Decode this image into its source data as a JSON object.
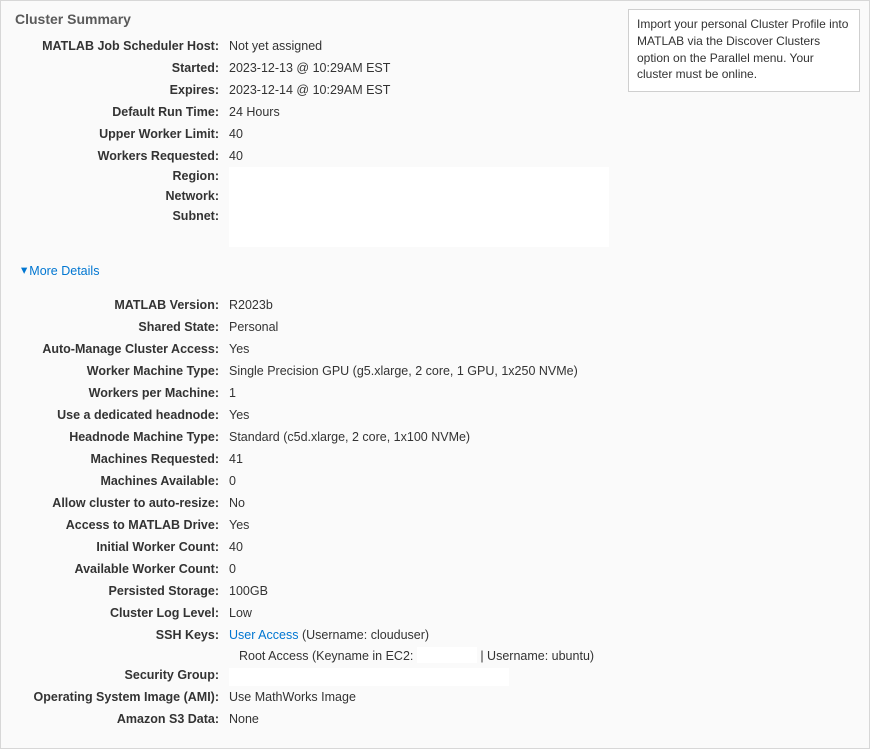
{
  "title": "Cluster Summary",
  "tip": "Import your personal Cluster Profile into MATLAB via the Discover Clusters option on the Parallel menu. Your cluster must be online.",
  "moreDetails": "More Details",
  "summary": {
    "hostLabel": "MATLAB Job Scheduler Host:",
    "hostValue": "Not yet assigned",
    "startedLabel": "Started:",
    "startedValue": "2023-12-13 @ 10:29AM EST",
    "expiresLabel": "Expires:",
    "expiresValue": "2023-12-14 @ 10:29AM EST",
    "runtimeLabel": "Default Run Time:",
    "runtimeValue": "24 Hours",
    "upperLimitLabel": "Upper Worker Limit:",
    "upperLimitValue": "40",
    "workersReqLabel": "Workers Requested:",
    "workersReqValue": "40",
    "regionLabel": "Region:",
    "networkLabel": "Network:",
    "subnetLabel": "Subnet:"
  },
  "details": {
    "matlabVerLabel": "MATLAB Version:",
    "matlabVerValue": "R2023b",
    "sharedStateLabel": "Shared State:",
    "sharedStateValue": "Personal",
    "autoManageLabel": "Auto-Manage Cluster Access:",
    "autoManageValue": "Yes",
    "workerTypeLabel": "Worker Machine Type:",
    "workerTypeValue": "Single Precision GPU (g5.xlarge, 2 core, 1 GPU, 1x250 NVMe)",
    "workersPerLabel": "Workers per Machine:",
    "workersPerValue": "1",
    "dedHeadLabel": "Use a dedicated headnode:",
    "dedHeadValue": "Yes",
    "headTypeLabel": "Headnode Machine Type:",
    "headTypeValue": "Standard (c5d.xlarge, 2 core, 1x100 NVMe)",
    "machReqLabel": "Machines Requested:",
    "machReqValue": "41",
    "machAvailLabel": "Machines Available:",
    "machAvailValue": "0",
    "autoResizeLabel": "Allow cluster to auto-resize:",
    "autoResizeValue": "No",
    "accessDriveLabel": "Access to MATLAB Drive:",
    "accessDriveValue": "Yes",
    "initWorkerLabel": "Initial Worker Count:",
    "initWorkerValue": "40",
    "availWorkerLabel": "Available Worker Count:",
    "availWorkerValue": "0",
    "storageLabel": "Persisted Storage:",
    "storageValue": "100GB",
    "logLevelLabel": "Cluster Log Level:",
    "logLevelValue": "Low",
    "sshLabel": "SSH Keys:",
    "sshUserLink": "User Access",
    "sshUserSuffix": " (Username: clouduser)",
    "sshRootPrefix": "Root Access (Keyname in EC2: ",
    "sshRootSuffix": " | Username: ubuntu)",
    "secGroupLabel": "Security Group:",
    "amiLabel": "Operating System Image (AMI):",
    "amiValue": "Use MathWorks Image",
    "s3Label": "Amazon S3 Data:",
    "s3Value": "None"
  }
}
